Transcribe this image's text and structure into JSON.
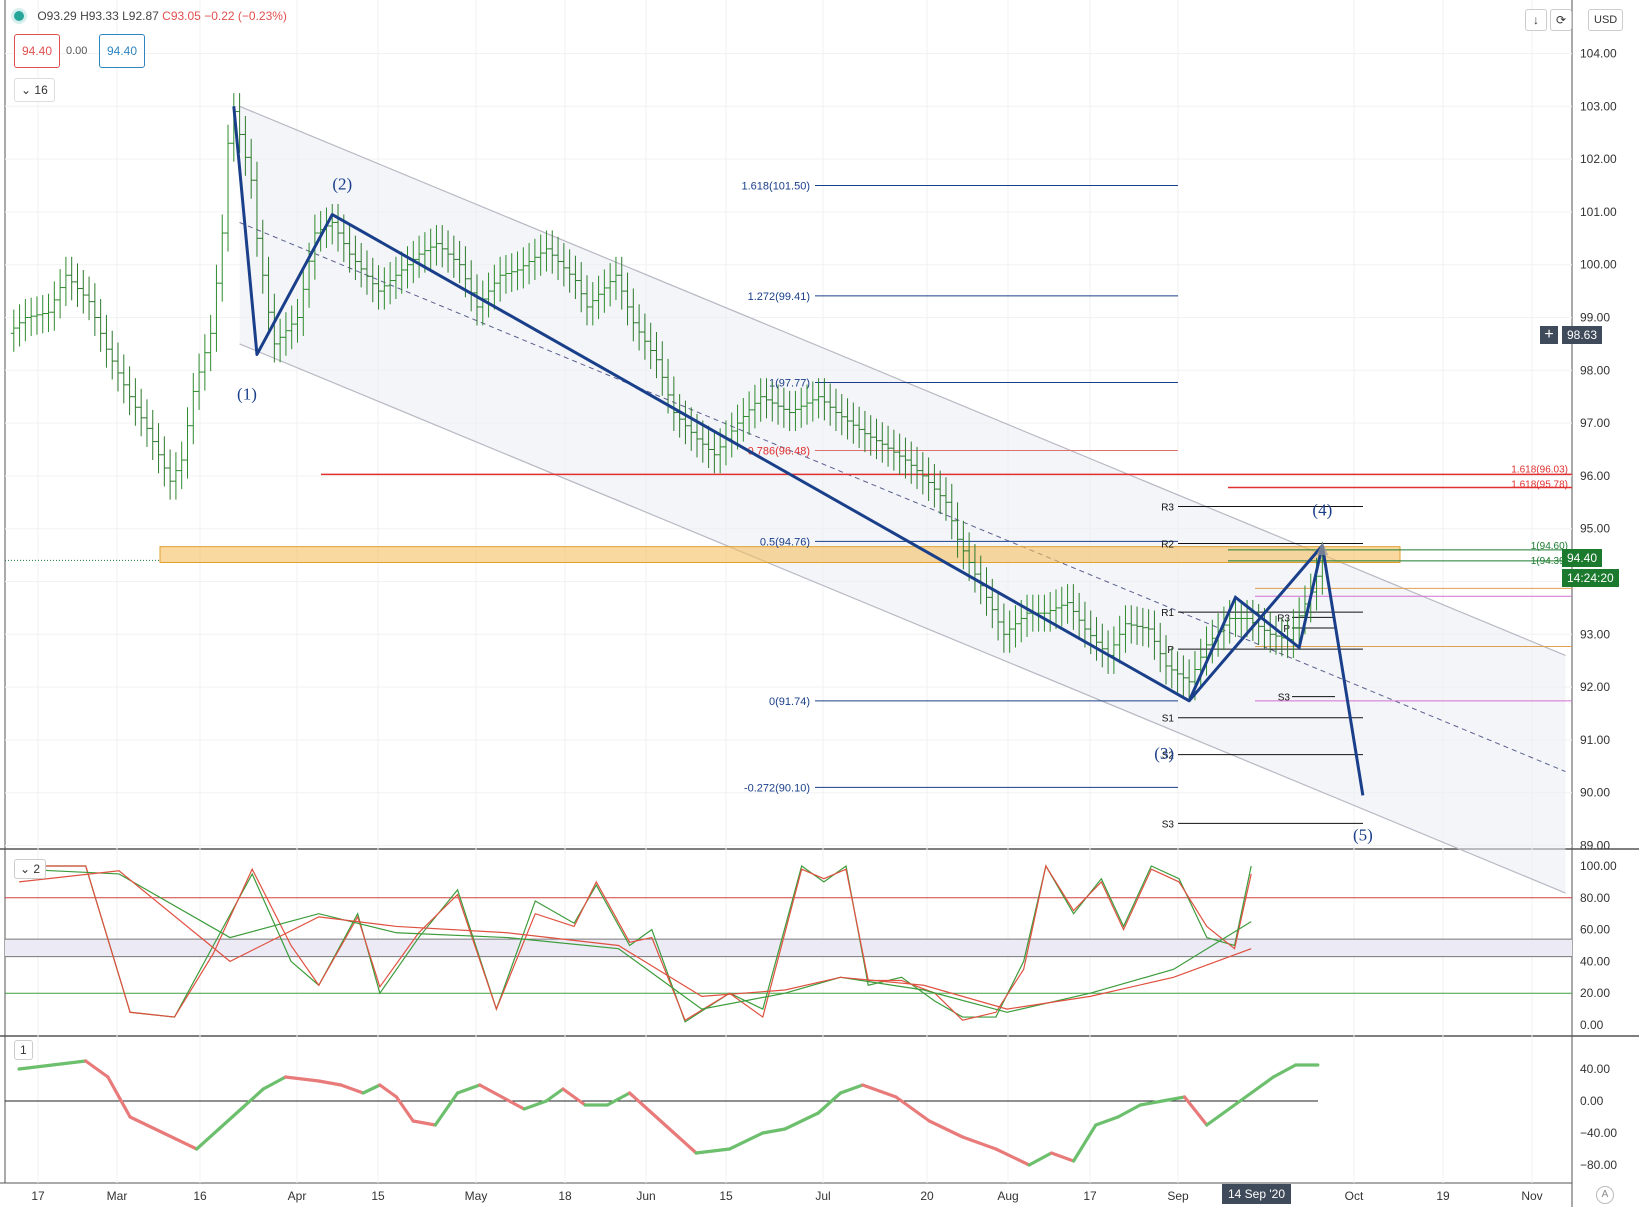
{
  "header": {
    "open": "O93.29",
    "high": "H93.33",
    "low": "L92.87",
    "close": "C93.05",
    "change": "−0.22 (−0.23%)",
    "bid": "94.40",
    "spread": "0.00",
    "ask": "94.40",
    "interval": "16",
    "currency": "USD",
    "download_icon": "arrow-down-icon",
    "refresh_icon": "refresh-icon"
  },
  "price_axis": {
    "labels": [
      "104.00",
      "103.00",
      "102.00",
      "101.00",
      "100.00",
      "99.00",
      "98.00",
      "97.00",
      "96.00",
      "95.00",
      "94.00",
      "93.00",
      "92.00",
      "91.00",
      "90.00",
      "89.00"
    ],
    "crosshair_label": "98.63",
    "last_price_label": "94.40",
    "timer_label": "14:24:20"
  },
  "stoch_axis": {
    "labels": [
      "100.00",
      "80.00",
      "60.00",
      "40.00",
      "20.00",
      "0.00"
    ]
  },
  "momentum_axis": {
    "labels": [
      "40.00",
      "0.00",
      "−40.00",
      "−80.00"
    ]
  },
  "time_axis": {
    "labels": [
      "17",
      "Mar",
      "16",
      "Apr",
      "15",
      "May",
      "18",
      "Jun",
      "15",
      "Jul",
      "20",
      "Aug",
      "17",
      "Sep",
      "Oct",
      "19",
      "Nov"
    ],
    "crosshair_label": "14 Sep '20"
  },
  "panes": {
    "stoch_button": "2",
    "momentum_button": "1"
  },
  "colors": {
    "up": "#2e8b2e",
    "wave": "#1a3f8a",
    "red_level": "#e03030",
    "zone": "#f5c060",
    "channel": "#b8b8c4"
  },
  "chart_data": [
    {
      "type": "ohlc",
      "title": "",
      "ylim": [
        89.0,
        104.0
      ],
      "elliott_waves": [
        {
          "label": "(1)",
          "date": "2020-03-24",
          "price": 98.3
        },
        {
          "label": "(2)",
          "date": "2020-04-06",
          "price": 100.95
        },
        {
          "label": "(3)",
          "date": "2020-09-01",
          "price": 91.74
        },
        {
          "label": "(4)",
          "date": "2020-09-24",
          "price": 94.68
        },
        {
          "label": "(5)",
          "date": "2020-10-01",
          "price": 89.95
        }
      ],
      "wave_start": {
        "date": "2020-03-20",
        "price": 103.0
      },
      "fibonacci_levels": [
        {
          "label": "1.618(101.50)",
          "value": 101.5
        },
        {
          "label": "1.272(99.41)",
          "value": 99.41
        },
        {
          "label": "1(97.77)",
          "value": 97.77
        },
        {
          "label": "0.786(96.48)",
          "value": 96.48
        },
        {
          "label": "0.5(94.76)",
          "value": 94.76
        },
        {
          "label": "0(91.74)",
          "value": 91.74
        },
        {
          "label": "-0.272(90.10)",
          "value": 90.1
        }
      ],
      "extension_levels": [
        {
          "label": "1.618(96.03)",
          "value": 96.03
        },
        {
          "label": "1.618(95.78)",
          "value": 95.78
        },
        {
          "label": "1(94.60)",
          "value": 94.6
        },
        {
          "label": "1(94.39)",
          "value": 94.39
        }
      ],
      "red_level": 96.03,
      "supply_zone": [
        94.36,
        94.66
      ],
      "pivot_levels_sep": [
        {
          "label": "R3",
          "value": 95.42
        },
        {
          "label": "R2",
          "value": 94.72
        },
        {
          "label": "R1",
          "value": 93.42
        },
        {
          "label": "P",
          "value": 92.72
        },
        {
          "label": "S1",
          "value": 91.42
        },
        {
          "label": "S2",
          "value": 90.72
        },
        {
          "label": "S3",
          "value": 89.42
        }
      ],
      "pivot_levels_week": [
        {
          "label": "R3",
          "value": 93.32
        },
        {
          "label": "P",
          "value": 93.12
        },
        {
          "label": "S3",
          "value": 91.82
        }
      ],
      "channel": {
        "start": "2020-03-21",
        "end": "2020-11-05",
        "upper": [
          103.0,
          92.6
        ],
        "middle": [
          100.8,
          90.4
        ],
        "lower": [
          98.5,
          88.1
        ]
      },
      "ohlc_daily_close": [
        [
          "2020-02-10",
          98.7
        ],
        [
          "2020-02-13",
          99.0
        ],
        [
          "2020-02-17",
          99.1
        ],
        [
          "2020-02-20",
          99.8
        ],
        [
          "2020-02-24",
          99.3
        ],
        [
          "2020-02-27",
          98.4
        ],
        [
          "2020-03-02",
          97.5
        ],
        [
          "2020-03-05",
          96.9
        ],
        [
          "2020-03-09",
          95.9
        ],
        [
          "2020-03-11",
          96.3
        ],
        [
          "2020-03-13",
          97.6
        ],
        [
          "2020-03-16",
          98.7
        ],
        [
          "2020-03-18",
          100.6
        ],
        [
          "2020-03-19",
          102.3
        ],
        [
          "2020-03-20",
          102.9
        ],
        [
          "2020-03-23",
          101.6
        ],
        [
          "2020-03-24",
          100.5
        ],
        [
          "2020-03-26",
          99.1
        ],
        [
          "2020-03-27",
          98.5
        ],
        [
          "2020-03-31",
          99.0
        ],
        [
          "2020-04-03",
          100.6
        ],
        [
          "2020-04-06",
          100.8
        ],
        [
          "2020-04-09",
          100.2
        ],
        [
          "2020-04-14",
          99.5
        ],
        [
          "2020-04-17",
          99.8
        ],
        [
          "2020-04-21",
          100.2
        ],
        [
          "2020-04-24",
          100.4
        ],
        [
          "2020-04-28",
          100.0
        ],
        [
          "2020-05-01",
          99.2
        ],
        [
          "2020-05-05",
          99.8
        ],
        [
          "2020-05-08",
          99.9
        ],
        [
          "2020-05-13",
          100.3
        ],
        [
          "2020-05-18",
          99.7
        ],
        [
          "2020-05-20",
          99.2
        ],
        [
          "2020-05-25",
          99.8
        ],
        [
          "2020-05-28",
          98.9
        ],
        [
          "2020-06-01",
          98.2
        ],
        [
          "2020-06-04",
          97.2
        ],
        [
          "2020-06-08",
          96.7
        ],
        [
          "2020-06-11",
          96.4
        ],
        [
          "2020-06-15",
          97.0
        ],
        [
          "2020-06-19",
          97.5
        ],
        [
          "2020-06-24",
          97.2
        ],
        [
          "2020-06-29",
          97.5
        ],
        [
          "2020-07-02",
          97.2
        ],
        [
          "2020-07-07",
          96.8
        ],
        [
          "2020-07-10",
          96.6
        ],
        [
          "2020-07-14",
          96.3
        ],
        [
          "2020-07-17",
          96.0
        ],
        [
          "2020-07-21",
          95.5
        ],
        [
          "2020-07-23",
          94.8
        ],
        [
          "2020-07-28",
          93.7
        ],
        [
          "2020-07-31",
          93.0
        ],
        [
          "2020-08-04",
          93.4
        ],
        [
          "2020-08-07",
          93.4
        ],
        [
          "2020-08-11",
          93.6
        ],
        [
          "2020-08-14",
          93.1
        ],
        [
          "2020-08-18",
          92.6
        ],
        [
          "2020-08-21",
          93.2
        ],
        [
          "2020-08-25",
          93.1
        ],
        [
          "2020-08-28",
          92.4
        ],
        [
          "2020-09-01",
          92.1
        ],
        [
          "2020-09-04",
          92.8
        ],
        [
          "2020-09-08",
          93.3
        ],
        [
          "2020-09-11",
          93.3
        ],
        [
          "2020-09-15",
          93.0
        ],
        [
          "2020-09-18",
          92.9
        ],
        [
          "2020-09-22",
          93.8
        ],
        [
          "2020-09-24",
          94.4
        ]
      ]
    },
    {
      "type": "line",
      "title": "",
      "ylim": [
        0,
        100
      ],
      "levels": [
        80,
        20
      ],
      "band": [
        43,
        54
      ],
      "series": [
        {
          "color": "#3c9c3c",
          "values": [
            [
              2,
              100
            ],
            [
              14,
              100
            ],
            [
              22,
              8
            ],
            [
              30,
              5
            ],
            [
              37,
              50
            ],
            [
              44,
              95
            ],
            [
              51,
              40
            ],
            [
              56,
              25
            ],
            [
              63,
              70
            ],
            [
              67,
              20
            ],
            [
              74,
              55
            ],
            [
              81,
              85
            ],
            [
              88,
              10
            ],
            [
              95,
              78
            ],
            [
              102,
              64
            ],
            [
              106,
              88
            ],
            [
              112,
              50
            ],
            [
              116,
              60
            ],
            [
              122,
              2
            ],
            [
              130,
              20
            ],
            [
              136,
              10
            ],
            [
              143,
              100
            ],
            [
              147,
              90
            ],
            [
              151,
              100
            ],
            [
              155,
              25
            ],
            [
              161,
              30
            ],
            [
              167,
              15
            ],
            [
              172,
              5
            ],
            [
              178,
              5
            ],
            [
              183,
              40
            ],
            [
              187,
              100
            ],
            [
              192,
              70
            ],
            [
              197,
              92
            ],
            [
              201,
              62
            ],
            [
              206,
              100
            ],
            [
              211,
              92
            ],
            [
              216,
              55
            ],
            [
              221,
              50
            ],
            [
              224,
              100
            ]
          ]
        },
        {
          "color": "#e05040",
          "values": [
            [
              2,
              100
            ],
            [
              14,
              100
            ],
            [
              22,
              8
            ],
            [
              30,
              5
            ],
            [
              37,
              45
            ],
            [
              44,
              98
            ],
            [
              51,
              50
            ],
            [
              56,
              25
            ],
            [
              63,
              68
            ],
            [
              67,
              24
            ],
            [
              74,
              58
            ],
            [
              81,
              82
            ],
            [
              88,
              10
            ],
            [
              95,
              70
            ],
            [
              102,
              62
            ],
            [
              106,
              90
            ],
            [
              112,
              52
            ],
            [
              116,
              55
            ],
            [
              122,
              3
            ],
            [
              130,
              20
            ],
            [
              136,
              5
            ],
            [
              143,
              98
            ],
            [
              147,
              92
            ],
            [
              151,
              98
            ],
            [
              155,
              28
            ],
            [
              161,
              28
            ],
            [
              167,
              20
            ],
            [
              172,
              3
            ],
            [
              178,
              8
            ],
            [
              183,
              35
            ],
            [
              187,
              100
            ],
            [
              192,
              72
            ],
            [
              197,
              90
            ],
            [
              201,
              60
            ],
            [
              206,
              98
            ],
            [
              211,
              90
            ],
            [
              216,
              62
            ],
            [
              221,
              48
            ],
            [
              224,
              95
            ]
          ]
        }
      ]
    },
    {
      "type": "line",
      "title": "",
      "ylim": [
        -100,
        70
      ],
      "levels": [
        0
      ],
      "series": [
        {
          "name": "",
          "values": [
            [
              2,
              40
            ],
            [
              8,
              45
            ],
            [
              14,
              50
            ],
            [
              18,
              30
            ],
            [
              22,
              -20
            ],
            [
              28,
              -40
            ],
            [
              34,
              -60
            ],
            [
              38,
              -35
            ],
            [
              42,
              -10
            ],
            [
              46,
              15
            ],
            [
              50,
              30
            ],
            [
              56,
              25
            ],
            [
              60,
              20
            ],
            [
              64,
              10
            ],
            [
              67,
              20
            ],
            [
              70,
              5
            ],
            [
              73,
              -25
            ],
            [
              77,
              -30
            ],
            [
              81,
              10
            ],
            [
              85,
              20
            ],
            [
              89,
              5
            ],
            [
              93,
              -10
            ],
            [
              97,
              0
            ],
            [
              100,
              15
            ],
            [
              104,
              -5
            ],
            [
              108,
              -5
            ],
            [
              112,
              10
            ],
            [
              116,
              -15
            ],
            [
              120,
              -40
            ],
            [
              124,
              -65
            ],
            [
              130,
              -60
            ],
            [
              136,
              -40
            ],
            [
              140,
              -35
            ],
            [
              146,
              -15
            ],
            [
              150,
              10
            ],
            [
              154,
              20
            ],
            [
              160,
              5
            ],
            [
              166,
              -25
            ],
            [
              172,
              -45
            ],
            [
              178,
              -60
            ],
            [
              184,
              -80
            ],
            [
              188,
              -65
            ],
            [
              192,
              -75
            ],
            [
              196,
              -30
            ],
            [
              200,
              -20
            ],
            [
              204,
              -5
            ],
            [
              208,
              0
            ],
            [
              212,
              5
            ],
            [
              216,
              -30
            ],
            [
              220,
              -10
            ],
            [
              224,
              10
            ],
            [
              228,
              30
            ],
            [
              232,
              45
            ],
            [
              236,
              45
            ]
          ]
        }
      ]
    }
  ]
}
